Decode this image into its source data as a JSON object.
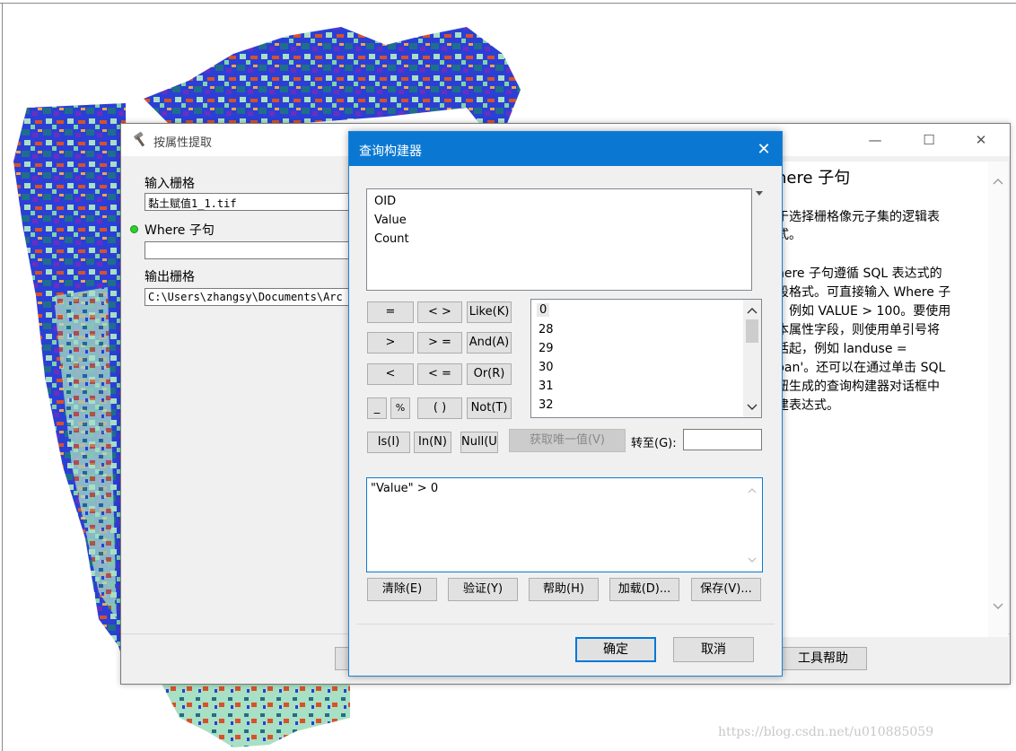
{
  "back_dialog": {
    "title": "按属性提取",
    "input_label": "输入栅格",
    "input_value": "黏土赋值1_1.tif",
    "where_label": "Where 子句",
    "where_value": "",
    "output_label": "输出栅格",
    "output_value": "C:\\Users\\zhangsy\\Documents\\Arc",
    "tool_help_button": "工具帮助",
    "minimize_glyph": "—",
    "maximize_glyph": "☐",
    "close_glyph": "✕",
    "help_heading": "here 子句",
    "help_lines": [
      "于选择栅格像元子集的逻辑表",
      "式。",
      "",
      "here 子句遵循 SQL 表达式的",
      "段格式。可直接输入 Where 子",
      "。例如 VALUE > 100。要使用",
      "本属性字段，则使用单引号将",
      "括起，例如 landuse =",
      "ban'。还可以在通过单击 SQL",
      "钮生成的查询构建器对话框中",
      "建表达式。"
    ]
  },
  "query_dialog": {
    "title": "查询构建器",
    "close_glyph": "✕",
    "fields": [
      "OID",
      "Value",
      "Count"
    ],
    "operators": {
      "eq": "=",
      "ne": "< >",
      "like": "Like(K)",
      "gt": ">",
      "ge": "> =",
      "and": "And(A)",
      "lt": "<",
      "le": "< =",
      "or": "Or(R)",
      "underscore": "_",
      "percent": "%",
      "parens": "( )",
      "not": "Not(T)",
      "is": "Is(I)",
      "in": "In(N)",
      "null": "Null(U)"
    },
    "unique_values": [
      "0",
      "28",
      "29",
      "30",
      "31",
      "32"
    ],
    "get_unique_button": "获取唯一值(V)",
    "goto_label": "转至(G):",
    "goto_value": "",
    "expression": "\"Value\" > 0",
    "buttons": {
      "clear": "清除(E)",
      "verify": "验证(Y)",
      "help": "帮助(H)",
      "load": "加载(D)...",
      "save": "保存(V)...",
      "ok": "确定",
      "cancel": "取消"
    }
  },
  "watermark": "https://blog.csdn.net/u010885059",
  "colors": {
    "accent": "#0a78d2",
    "dialog_bg": "#f0f0f0",
    "map_blue": "#2b3fd6",
    "map_teal": "#1f6e8c",
    "map_mint": "#a8e0c4",
    "map_red": "#d8512a"
  }
}
